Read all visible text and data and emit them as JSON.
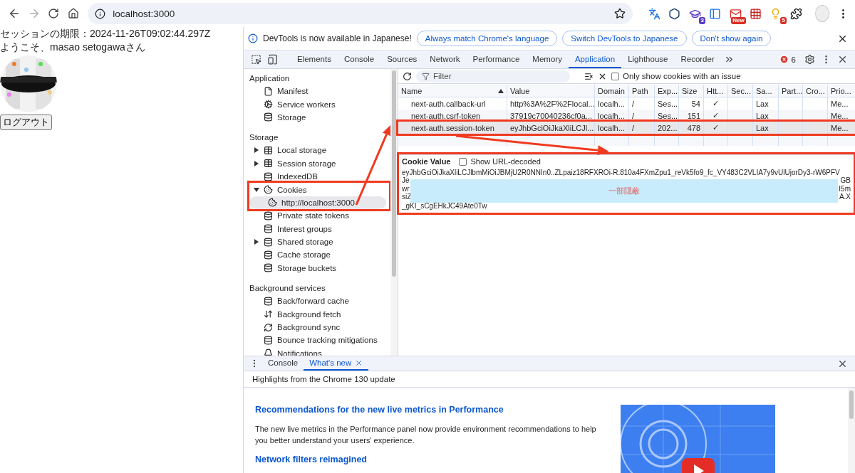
{
  "browser": {
    "url": "localhost:3000",
    "extension_badges": [
      "3",
      "New",
      "5"
    ]
  },
  "page": {
    "session_expiry": "セッションの期限：2024-11-26T09:02:44.297Z",
    "welcome": "ようこそ、masao setogawaさん",
    "logout_button": "ログアウト"
  },
  "devtools": {
    "infobar": {
      "message": "DevTools is now available in Japanese!",
      "buttons": [
        "Always match Chrome's language",
        "Switch DevTools to Japanese",
        "Don't show again"
      ]
    },
    "tabs": [
      {
        "label": "Elements",
        "selected": false
      },
      {
        "label": "Console",
        "selected": false
      },
      {
        "label": "Sources",
        "selected": false
      },
      {
        "label": "Network",
        "selected": false
      },
      {
        "label": "Performance",
        "selected": false
      },
      {
        "label": "Memory",
        "selected": false
      },
      {
        "label": "Application",
        "selected": true
      },
      {
        "label": "Lighthouse",
        "selected": false
      },
      {
        "label": "Recorder",
        "selected": false
      }
    ],
    "error_count": "6",
    "sidebar": [
      {
        "title": "Application",
        "items": [
          {
            "label": "Manifest",
            "selected": false
          },
          {
            "label": "Service workers",
            "selected": false
          },
          {
            "label": "Storage",
            "selected": false
          }
        ]
      },
      {
        "title": "Storage",
        "items": [
          {
            "label": "Local storage",
            "selected": false,
            "expanded": false
          },
          {
            "label": "Session storage",
            "selected": false,
            "expanded": false
          },
          {
            "label": "IndexedDB",
            "selected": false
          },
          {
            "label": "Cookies",
            "selected": false,
            "expanded": true,
            "highlighted": true,
            "children": [
              {
                "label": "http://localhost:3000",
                "selected": true
              }
            ]
          },
          {
            "label": "Private state tokens",
            "selected": false
          },
          {
            "label": "Interest groups",
            "selected": false
          },
          {
            "label": "Shared storage",
            "selected": false,
            "expanded": false
          },
          {
            "label": "Cache storage",
            "selected": false
          },
          {
            "label": "Storage buckets",
            "selected": false
          }
        ]
      },
      {
        "title": "Background services",
        "items": [
          {
            "label": "Back/forward cache",
            "selected": false
          },
          {
            "label": "Background fetch",
            "selected": false
          },
          {
            "label": "Background sync",
            "selected": false
          },
          {
            "label": "Bounce tracking mitigations",
            "selected": false
          },
          {
            "label": "Notifications",
            "selected": false
          }
        ]
      }
    ],
    "cookie_toolbar": {
      "filter_placeholder": "Filter",
      "issue_checkbox": {
        "label": "Only show cookies with an issue",
        "checked": false
      }
    },
    "cookie_table": {
      "columns": [
        {
          "label": "Name",
          "sorted": true
        },
        {
          "label": "Value",
          "sorted": false
        },
        {
          "label": "Domain",
          "sorted": false
        },
        {
          "label": "Path",
          "sorted": false
        },
        {
          "label": "Exp...",
          "sorted": false
        },
        {
          "label": "Size",
          "sorted": false
        },
        {
          "label": "Htt...",
          "sorted": false
        },
        {
          "label": "Sec...",
          "sorted": false
        },
        {
          "label": "Sa...",
          "sorted": false
        },
        {
          "label": "Part...",
          "sorted": false
        },
        {
          "label": "Cro...",
          "sorted": false
        },
        {
          "label": "Prio...",
          "sorted": false
        }
      ],
      "rows": [
        {
          "selected": false,
          "highlighted": false,
          "cells": [
            "next-auth.callback-url",
            "http%3A%2F%2Flocal...",
            "localh...",
            "/",
            "Ses...",
            "54",
            "✓",
            "",
            "Lax",
            "",
            "",
            "Me..."
          ]
        },
        {
          "selected": false,
          "highlighted": false,
          "cells": [
            "next-auth.csrf-token",
            "37919c70040236cf0a...",
            "localh...",
            "/",
            "Ses...",
            "151",
            "✓",
            "",
            "Lax",
            "",
            "",
            "Me..."
          ]
        },
        {
          "selected": true,
          "highlighted": true,
          "cells": [
            "next-auth.session-token",
            "eyJhbGciOiJkaXliLCJl...",
            "localh...",
            "/",
            "202...",
            "478",
            "✓",
            "",
            "Lax",
            "",
            "",
            "Me..."
          ]
        }
      ]
    },
    "cookie_value": {
      "title": "Cookie Value",
      "highlighted": true,
      "url_decoded_checkbox": {
        "label": "Show URL-decoded",
        "checked": false
      },
      "first_line": "eyJhbGciOiJkaXliLCJlbmMiOiJBMjU2R0NNIn0..ZLpaiz18RFXROi-R.810a4FXmZpu1_reVk5fo9_fc_VY483C2VLIA7y9vUlUjorDy3-rW6PFV",
      "partial_lines": [
        {
          "start": "Je",
          "end": "GB"
        },
        {
          "start": "wr",
          "end": "I5m"
        },
        {
          "start": "siZ",
          "end": "A.X"
        }
      ],
      "last_line": "_gKI_sCgEHkJC49Ate0Tw",
      "mask_label": "一部隠蔽"
    },
    "drawer": {
      "tabs": [
        {
          "label": "Console",
          "selected": false,
          "closable": false
        },
        {
          "label": "What's new",
          "selected": true,
          "closable": true
        }
      ],
      "header": "Highlights from the Chrome 130 update",
      "articles": [
        {
          "title": "Recommendations for the new live metrics in Performance",
          "body": "The new live metrics in the Performance panel now provide environment recommendations to help you better understand your users' experience."
        },
        {
          "title": "Network filters reimagined"
        }
      ]
    }
  }
}
